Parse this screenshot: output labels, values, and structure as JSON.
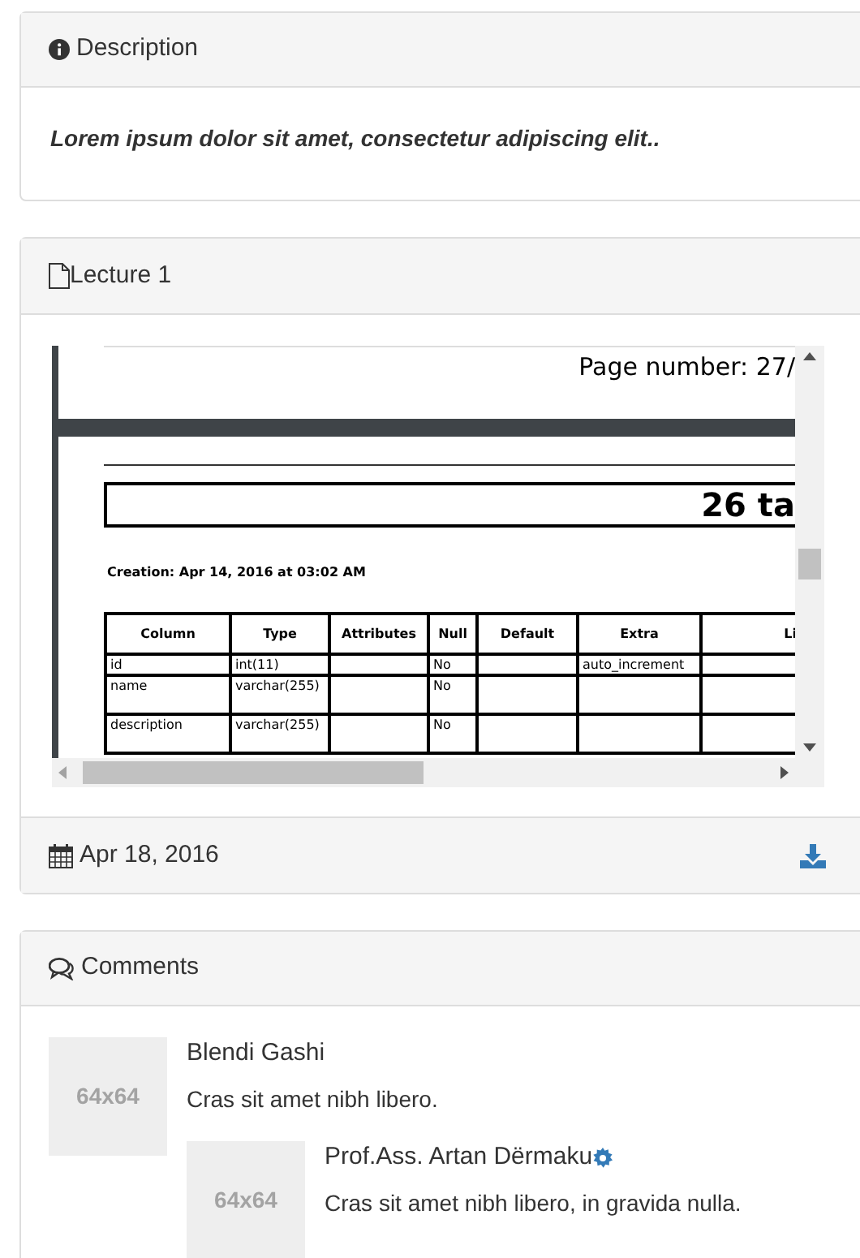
{
  "description": {
    "title": "Description",
    "text": "Lorem ipsum dolor sit amet, consectetur adipiscing elit.."
  },
  "lecture": {
    "title": "Lecture 1",
    "document": {
      "page_number": "Page number: 27/",
      "heading": "26 ta",
      "creation": "Creation: Apr 14, 2016 at 03:02 AM",
      "columns": [
        "Column",
        "Type",
        "Attributes",
        "Null",
        "Default",
        "Extra",
        "Li"
      ],
      "rows": [
        [
          "id",
          "int(11)",
          "",
          "No",
          "",
          "auto_increment",
          ""
        ],
        [
          "name",
          "varchar(255)",
          "",
          "No",
          "",
          "",
          ""
        ],
        [
          "description",
          "varchar(255)",
          "",
          "No",
          "",
          "",
          ""
        ]
      ]
    },
    "date": "Apr 18, 2016"
  },
  "comments": {
    "title": "Comments",
    "items": [
      {
        "avatar": "64x64",
        "author": "Blendi Gashi",
        "admin": false,
        "text": "Cras sit amet nibh libero.",
        "replies": [
          {
            "avatar": "64x64",
            "author": "Prof.Ass. Artan Dërmaku",
            "admin": true,
            "text": "Cras sit amet nibh libero, in gravida nulla."
          }
        ]
      }
    ]
  }
}
